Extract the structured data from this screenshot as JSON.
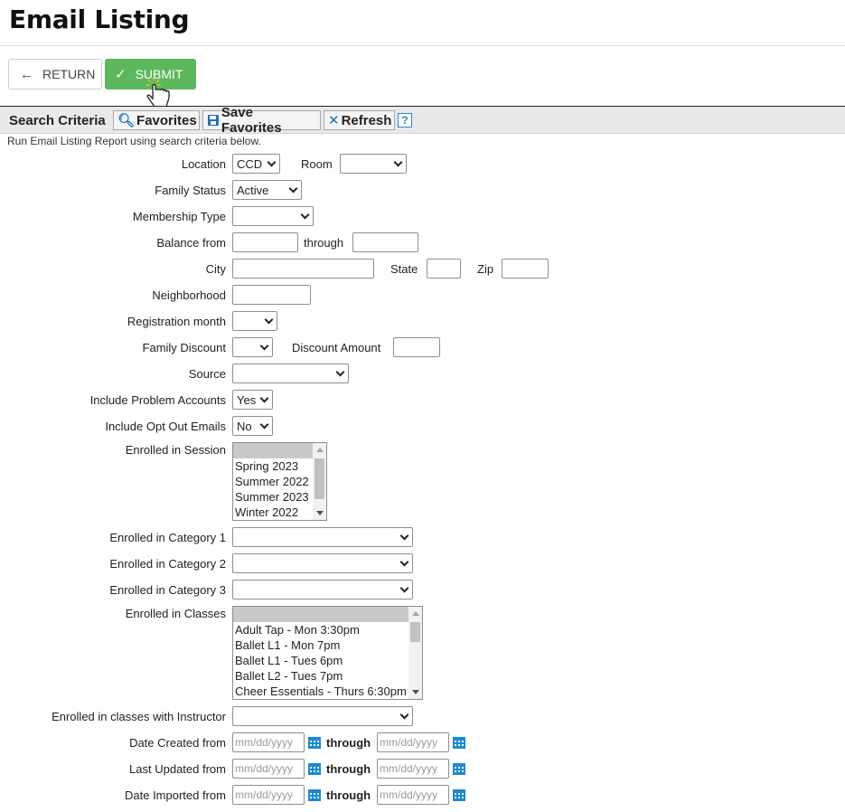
{
  "title": "Email Listing",
  "actions": {
    "return_label": "RETURN",
    "submit_label": "SUBMIT"
  },
  "toolbar": {
    "label": "Search Criteria",
    "favorites_label": "Favorites",
    "save_favorites_label": "Save Favorites",
    "refresh_label": "Refresh",
    "help_label": "?"
  },
  "intro": "Run Email Listing Report using search criteria below.",
  "form": {
    "location_label": "Location",
    "location_value": "CCD",
    "room_label": "Room",
    "room_value": "",
    "family_status_label": "Family Status",
    "family_status_value": "Active",
    "membership_type_label": "Membership Type",
    "membership_type_value": "",
    "balance_from_label": "Balance from",
    "through_label": "through",
    "city_label": "City",
    "state_label": "State",
    "zip_label": "Zip",
    "neighborhood_label": "Neighborhood",
    "registration_month_label": "Registration month",
    "registration_month_value": "",
    "family_discount_label": "Family Discount",
    "family_discount_value": "",
    "discount_amount_label": "Discount Amount",
    "source_label": "Source",
    "source_value": "",
    "problem_accounts_label": "Include Problem Accounts",
    "problem_accounts_value": "Yes",
    "opt_out_label": "Include Opt Out Emails",
    "opt_out_value": "No",
    "session_label": "Enrolled in Session",
    "session_options": [
      "",
      "Spring 2023",
      "Summer 2022",
      "Summer 2023",
      "Winter 2022"
    ],
    "category1_label": "Enrolled in Category 1",
    "category2_label": "Enrolled in Category 2",
    "category3_label": "Enrolled in Category 3",
    "classes_label": "Enrolled in Classes",
    "classes_options": [
      "",
      "Adult Tap - Mon 3:30pm",
      "Ballet L1 - Mon 7pm",
      "Ballet L1 - Tues 6pm",
      "Ballet L2 - Tues 7pm",
      "Cheer Essentials - Thurs 6:30pm"
    ],
    "instructor_label": "Enrolled in classes with Instructor",
    "date_created_label": "Date Created from",
    "last_updated_label": "Last Updated from",
    "date_imported_label": "Date Imported from",
    "date_placeholder": "mm/dd/yyyy"
  },
  "colors": {
    "submit": "#5cb85c",
    "accent": "#1a6fbf"
  }
}
